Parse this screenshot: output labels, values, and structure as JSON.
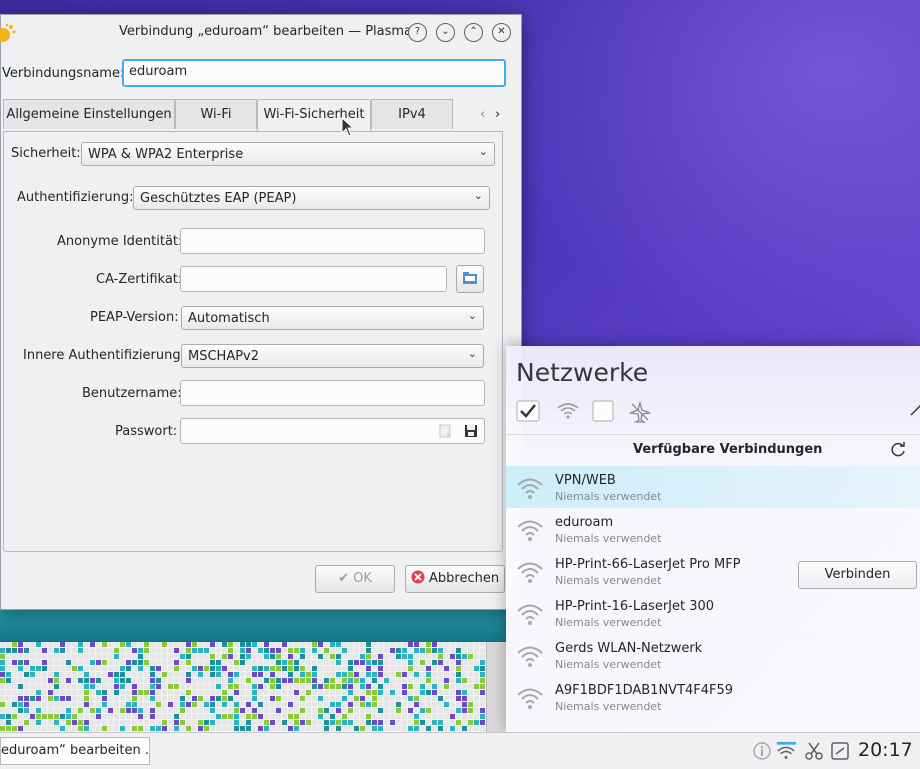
{
  "dialog": {
    "title": "Verbindung „eduroam“ bearbeiten — Plasma",
    "buttons": {
      "help": "?",
      "minimize": "⌄",
      "maximize": "⌃",
      "close": "✕"
    },
    "connection_name_label": "Verbindungsname:",
    "connection_name_value": "eduroam",
    "tabs": [
      {
        "label": "Allgemeine Einstellungen"
      },
      {
        "label": "Wi-Fi"
      },
      {
        "label": "Wi-Fi-Sicherheit"
      },
      {
        "label": "IPv4"
      }
    ],
    "tab_prev": "‹",
    "tab_next": "›",
    "security_label": "Sicherheit:",
    "security_value": "WPA & WPA2 Enterprise",
    "auth_label": "Authentifizierung:",
    "auth_value": "Geschütztes EAP (PEAP)",
    "anon_identity_label": "Anonyme Identität:",
    "anon_identity_value": "",
    "ca_cert_label": "CA-Zertifikat:",
    "ca_cert_value": "",
    "peap_version_label": "PEAP-Version:",
    "peap_version_value": "Automatisch",
    "inner_auth_label": "Innere Authentifizierung:",
    "inner_auth_value": "MSCHAPv2",
    "username_label": "Benutzername:",
    "username_value": "",
    "password_label": "Passwort:",
    "password_value": "",
    "ok_label": "OK",
    "cancel_label": "Abbrechen"
  },
  "applet": {
    "title": "Netzwerke",
    "available_title": "Verfügbare Verbindungen",
    "connect_label": "Verbinden",
    "connections": [
      {
        "name": "VPN/WEB",
        "status": "Niemals verwendet"
      },
      {
        "name": "eduroam",
        "status": "Niemals verwendet"
      },
      {
        "name": "HP-Print-66-LaserJet Pro MFP",
        "status": "Niemals verwendet"
      },
      {
        "name": "HP-Print-16-LaserJet 300",
        "status": "Niemals verwendet"
      },
      {
        "name": "Gerds WLAN-Netzwerk",
        "status": "Niemals verwendet"
      },
      {
        "name": "A9F1BDF1DAB1NVT4F4F59",
        "status": "Niemals verwendet"
      }
    ]
  },
  "taskbar": {
    "task_label": "eduroam“ bearbeiten ...",
    "clock": "20:17"
  },
  "colors": {
    "accent": "#3daee9",
    "cancel_red": "#da4453"
  }
}
